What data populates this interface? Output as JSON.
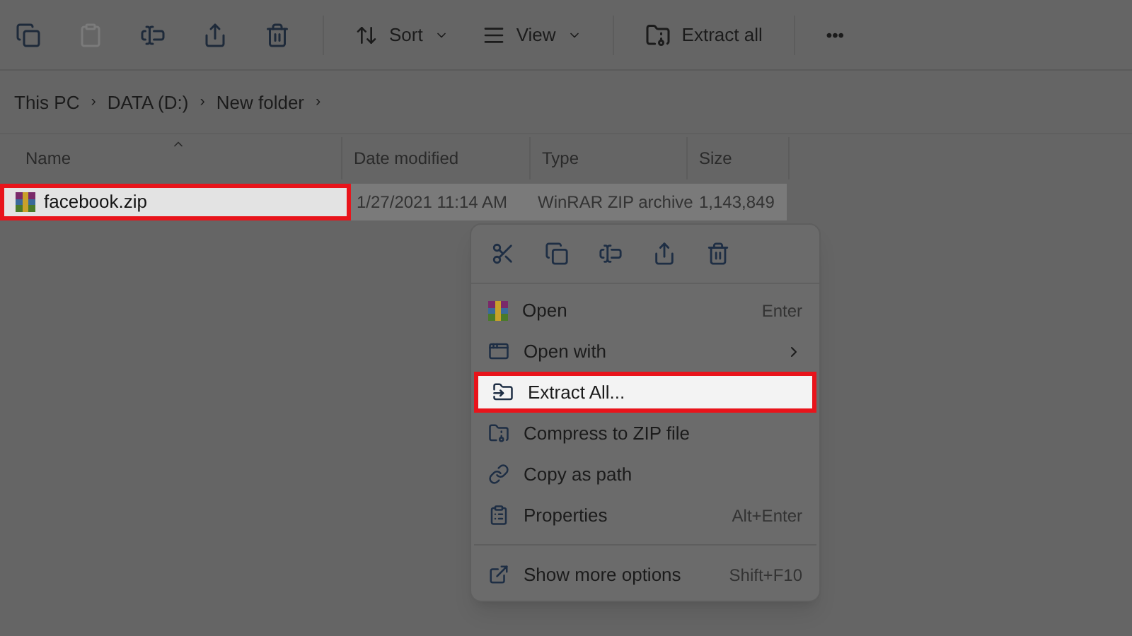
{
  "toolbar": {
    "icon_buttons": [
      {
        "disabled": false
      },
      {
        "disabled": true
      },
      {
        "disabled": false
      },
      {
        "disabled": false
      },
      {
        "disabled": false
      }
    ],
    "menus": [
      {
        "label": "Sort"
      },
      {
        "label": "View"
      }
    ],
    "extract": {
      "label": "Extract all"
    },
    "more": "•••"
  },
  "breadcrumb": [
    "This PC",
    "DATA (D:)",
    "New folder"
  ],
  "breadcrumb_separator": "›",
  "columns": [
    {
      "label": "Name",
      "sorted": true
    },
    {
      "label": "Date modified",
      "sorted": false
    },
    {
      "label": "Type",
      "sorted": false
    },
    {
      "label": "Size",
      "sorted": false
    }
  ],
  "rows": [
    {
      "name": "facebook.zip",
      "date": "1/27/2021 11:14 AM",
      "type": "WinRAR ZIP archive",
      "size": "1,143,849",
      "selected": true,
      "highlighted": true
    }
  ],
  "context_menu": {
    "quick_actions": [
      {
        "disabled": false
      },
      {
        "disabled": false
      },
      {
        "disabled": false
      },
      {
        "disabled": false
      },
      {
        "disabled": false
      }
    ],
    "items": [
      {
        "kind": "item",
        "label": "Open",
        "shortcut": "Enter",
        "highlighted": false,
        "submenu": false
      },
      {
        "kind": "item",
        "label": "Open with",
        "highlighted": false,
        "submenu": true
      },
      {
        "kind": "item",
        "label": "Extract All...",
        "highlighted": true,
        "submenu": false
      },
      {
        "kind": "item",
        "label": "Compress to ZIP file",
        "highlighted": false,
        "submenu": false
      },
      {
        "kind": "item",
        "label": "Copy as path",
        "highlighted": false,
        "submenu": false
      },
      {
        "kind": "item",
        "label": "Properties",
        "shortcut": "Alt+Enter",
        "highlighted": false,
        "submenu": false
      },
      {
        "kind": "separator"
      },
      {
        "kind": "item",
        "label": "Show more options",
        "shortcut": "Shift+F10",
        "highlighted": false,
        "submenu": false
      }
    ]
  }
}
